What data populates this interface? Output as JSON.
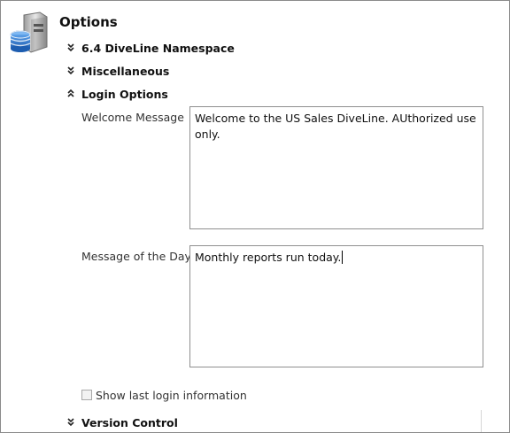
{
  "header": {
    "title": "Options",
    "icon": "database-server-icon"
  },
  "sections": {
    "namespace": {
      "label": "6.4 DiveLine Namespace",
      "state": "collapsed"
    },
    "misc": {
      "label": "Miscellaneous",
      "state": "collapsed"
    },
    "login": {
      "label": "Login Options",
      "state": "expanded"
    },
    "version": {
      "label": "Version Control",
      "state": "collapsed"
    }
  },
  "login_options": {
    "welcome_label": "Welcome Message",
    "welcome_value": "Welcome to the US Sales DiveLine. AUthorized use only.",
    "motd_label": "Message of the Day",
    "motd_value": "Monthly reports run today.",
    "show_last_login_label": "Show last login information",
    "show_last_login_checked": false
  },
  "colors": {
    "border": "#8a8a8a",
    "field_border": "#8f8f8f",
    "icon_blue": "#2f6fc4"
  }
}
